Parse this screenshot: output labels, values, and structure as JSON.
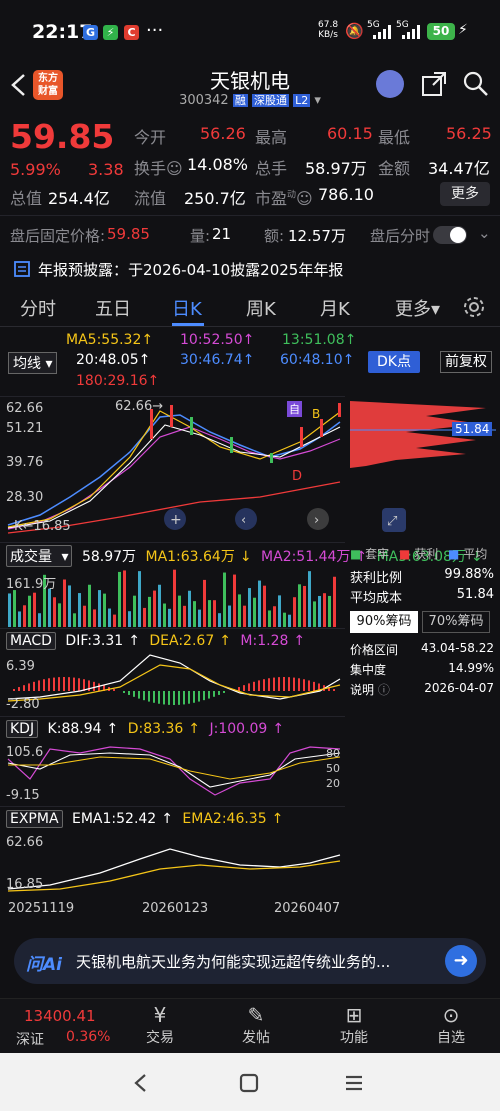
{
  "status": {
    "time": "22:17",
    "net_speed_top": "67.8",
    "net_speed_unit": "KB/s",
    "sig1": "5G",
    "sig2": "5G",
    "battery": "50",
    "dots": "···"
  },
  "header": {
    "logo_line1": "东方",
    "logo_line2": "财富",
    "title": "天银机电",
    "code": "300342",
    "tag1": "融",
    "tag2": "深股通",
    "tag3": "L2"
  },
  "quote": {
    "price": "59.85",
    "change_pct": "5.99%",
    "change": "3.38",
    "open_label": "今开",
    "open": "56.26",
    "high_label": "最高",
    "high": "60.15",
    "low_label": "最低",
    "low": "56.25",
    "turnover_label": "换手",
    "turnover": "14.08%",
    "volume_label": "总手",
    "volume": "58.97万",
    "amount_label": "金额",
    "amount": "34.47亿",
    "mcap_label": "总值",
    "mcap": "254.4亿",
    "float_label": "流值",
    "float": "250.7亿",
    "pe_label": "市盈",
    "pe_sup": "动",
    "pe": "786.10",
    "more": "更多"
  },
  "afterhours": {
    "label": "盘后固定价格:",
    "price": "59.85",
    "qty_label": "量:",
    "qty": "21",
    "amt_label": "额:",
    "amt": "12.57万",
    "timeshare_label": "盘后分时"
  },
  "notice": {
    "text": "年报预披露：于2026-04-10披露2025年年报"
  },
  "tabs": [
    "分时",
    "五日",
    "日K",
    "周K",
    "月K",
    "更多"
  ],
  "ma": {
    "selector": "均线",
    "ma5": "MA5:55.32",
    "ma10": "10:52.50",
    "ma13": "13:51.08",
    "ma20": "20:48.05",
    "ma30": "30:46.74",
    "ma60": "60:48.10",
    "ma180": "180:29.16",
    "dk": "DK点",
    "adj": "前复权"
  },
  "kchart": {
    "y_high": "62.66",
    "y2": "51.21",
    "y3": "39.76",
    "y4": "28.30",
    "y_low": "16.85",
    "max_label": "62.66",
    "min_label": "16.85",
    "marker_d": "D",
    "marker_b": "B",
    "marker_self": "自"
  },
  "vol": {
    "label": "成交量",
    "value": "58.97万",
    "ma1": "MA1:63.64万",
    "ma2": "MA2:51.44万",
    "ma3": "MA3:63.08万",
    "y": "161.9万"
  },
  "macd": {
    "label": "MACD",
    "dif": "DIF:3.31",
    "dea": "DEA:2.67",
    "m": "M:1.28",
    "y_high": "6.39",
    "y_low": "-2.80"
  },
  "kdj": {
    "label": "KDJ",
    "k": "K:88.94",
    "d": "D:83.36",
    "j": "J:100.09",
    "y_high": "105.6",
    "y_low": "-9.15",
    "r80": "80",
    "r50": "50",
    "r20": "20"
  },
  "expma": {
    "label": "EXPMA",
    "ema1": "EMA1:52.42",
    "ema2": "EMA2:46.35",
    "y_high": "62.66",
    "y_low": "16.85"
  },
  "dates": {
    "d1": "20251119",
    "d2": "20260123",
    "d3": "20260407"
  },
  "chips": {
    "legend1": "套牢",
    "legend2": "获利",
    "legend3": "平均",
    "price_tag": "51.84",
    "profit_ratio_label": "获利比例",
    "profit_ratio": "99.88%",
    "avg_cost_label": "平均成本",
    "avg_cost": "51.84",
    "tab90": "90%筹码",
    "tab70": "70%筹码",
    "range_label": "价格区间",
    "range": "43.04-58.22",
    "conc_label": "集中度",
    "conc": "14.99%",
    "note_label": "说明",
    "note_date": "2026-04-07"
  },
  "ai": {
    "brand": "问Ai",
    "text": "天银机电航天业务为何能实现远超传统业务的..."
  },
  "nav": {
    "index_value": "13400.41",
    "index_name": "深证",
    "index_pct": "0.36%",
    "trade": "交易",
    "post": "发帖",
    "func": "功能",
    "watch": "自选"
  }
}
